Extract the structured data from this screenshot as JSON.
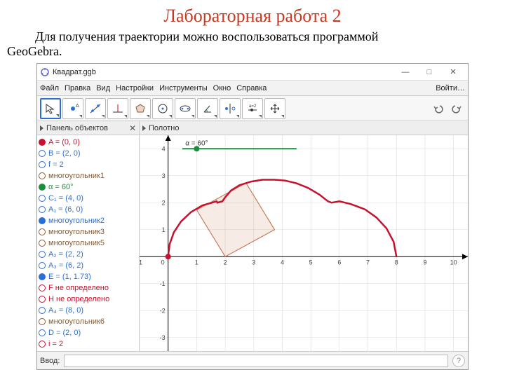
{
  "page": {
    "title": "Лабораторная работа 2",
    "intro_line1": "Для получения траектории можно воспользоваться программой",
    "intro_line2": "GeoGebra."
  },
  "titlebar": {
    "filename": "Квадрат.ggb",
    "min": "—",
    "max": "□",
    "close": "✕"
  },
  "menu": {
    "file": "Файл",
    "edit": "Правка",
    "view": "Вид",
    "settings": "Настройки",
    "tools": "Инструменты",
    "window": "Окно",
    "help": "Справка",
    "login": "Войти…"
  },
  "panels": {
    "objects_title": "Панель объектов",
    "canvas_title": "Полотно",
    "close_x": "✕"
  },
  "slider": {
    "label": "α = 60°"
  },
  "objects": [
    {
      "label": "A = (0, 0)",
      "color": "#c8102e",
      "filled": true
    },
    {
      "label": "B = (2, 0)",
      "color": "#2a6fd6",
      "filled": false
    },
    {
      "label": "f = 2",
      "color": "#2a6fd6",
      "filled": false
    },
    {
      "label": "многоугольник1",
      "color": "#8a5a2b",
      "filled": false
    },
    {
      "label": "α = 60°",
      "color": "#1a8f3b",
      "filled": true
    },
    {
      "label": "C₁ = (4, 0)",
      "color": "#2a6fd6",
      "filled": false
    },
    {
      "label": "A₁ = (6, 0)",
      "color": "#2a6fd6",
      "filled": false
    },
    {
      "label": "многоугольник2",
      "color": "#2a6fd6",
      "filled": true
    },
    {
      "label": "многоугольник3",
      "color": "#8a5a2b",
      "filled": false
    },
    {
      "label": "многоугольник5",
      "color": "#8a5a2b",
      "filled": false
    },
    {
      "label": "A₂ = (2, 2)",
      "color": "#2a6fd6",
      "filled": false
    },
    {
      "label": "A₃ = (6, 2)",
      "color": "#2a6fd6",
      "filled": false
    },
    {
      "label": "E = (1, 1.73)",
      "color": "#2a6fd6",
      "filled": true
    },
    {
      "label": "F не определено",
      "color": "#c8102e",
      "filled": false
    },
    {
      "label": "H не определено",
      "color": "#c8102e",
      "filled": false
    },
    {
      "label": "A₄ = (8, 0)",
      "color": "#2a6fd6",
      "filled": false
    },
    {
      "label": "многоугольник6",
      "color": "#8a5a2b",
      "filled": false
    },
    {
      "label": "D = (2, 0)",
      "color": "#2a6fd6",
      "filled": false
    },
    {
      "label": "i = 2",
      "color": "#c8102e",
      "filled": false
    }
  ],
  "inputbar": {
    "label": "Ввод:",
    "help": "?"
  },
  "chart_data": {
    "type": "line",
    "title": "",
    "xlabel": "",
    "ylabel": "",
    "xlim": [
      -1,
      10.5
    ],
    "ylim": [
      -3.5,
      4.5
    ],
    "xticks": [
      -1,
      0,
      1,
      2,
      3,
      4,
      5,
      6,
      7,
      8,
      9,
      10
    ],
    "yticks": [
      -3,
      -2,
      -1,
      0,
      1,
      2,
      3,
      4
    ],
    "series": [
      {
        "name": "trajectory",
        "color": "#c8102e",
        "points": [
          [
            0,
            0
          ],
          [
            0.05,
            0.45
          ],
          [
            0.2,
            0.9
          ],
          [
            0.45,
            1.3
          ],
          [
            0.8,
            1.65
          ],
          [
            1.2,
            1.9
          ],
          [
            1.7,
            2.05
          ],
          [
            1.73,
            2.0
          ],
          [
            1.9,
            2.05
          ],
          [
            2.0,
            2.2
          ],
          [
            2.2,
            2.45
          ],
          [
            2.5,
            2.65
          ],
          [
            2.9,
            2.78
          ],
          [
            3.3,
            2.85
          ],
          [
            3.73,
            2.85
          ],
          [
            4.1,
            2.82
          ],
          [
            4.5,
            2.72
          ],
          [
            4.9,
            2.55
          ],
          [
            5.3,
            2.3
          ],
          [
            5.6,
            2.05
          ],
          [
            5.73,
            2.0
          ],
          [
            6.0,
            2.05
          ],
          [
            6.4,
            1.95
          ],
          [
            6.9,
            1.75
          ],
          [
            7.3,
            1.45
          ],
          [
            7.65,
            1.05
          ],
          [
            7.9,
            0.55
          ],
          [
            8.0,
            0.0
          ]
        ]
      }
    ],
    "square": {
      "color": "#c97a5a",
      "fill": "rgba(201,122,90,0.15)",
      "vertices": [
        [
          2,
          0
        ],
        [
          3.73,
          1.0
        ],
        [
          2.73,
          2.73
        ],
        [
          1.0,
          1.73
        ]
      ]
    },
    "markers": [
      {
        "name": "A",
        "x": 0,
        "y": 0,
        "color": "#c8102e"
      },
      {
        "name": "slider_knob",
        "x": 1.0,
        "y": 4.0,
        "color": "#1a8f3b"
      }
    ],
    "slider_track": {
      "x0": 0.5,
      "x1": 4.5,
      "y": 4.0,
      "color": "#1a8f3b"
    }
  }
}
